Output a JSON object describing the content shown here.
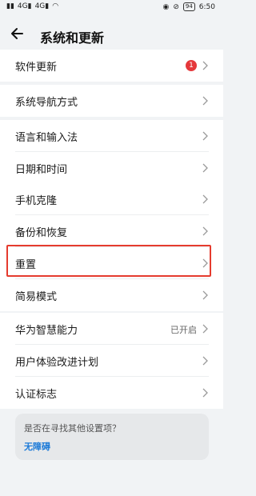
{
  "status_bar": {
    "left": [
      "HD",
      "4G",
      "4G",
      "wifi"
    ],
    "battery": "94",
    "time": "6:50"
  },
  "header": {
    "title": "系统和更新"
  },
  "groups": [
    {
      "items": [
        {
          "label": "软件更新",
          "badge": "1"
        }
      ]
    },
    {
      "items": [
        {
          "label": "系统导航方式"
        }
      ]
    },
    {
      "items": [
        {
          "label": "语言和输入法"
        },
        {
          "label": "日期和时间"
        }
      ]
    },
    {
      "items": [
        {
          "label": "手机克隆"
        },
        {
          "label": "备份和恢复"
        },
        {
          "label": "重置"
        },
        {
          "label": "简易模式"
        }
      ]
    },
    {
      "items": [
        {
          "label": "华为智慧能力",
          "value": "已开启"
        },
        {
          "label": "用户体验改进计划"
        },
        {
          "label": "认证标志"
        }
      ]
    }
  ],
  "hint": {
    "question": "是否在寻找其他设置项？",
    "link": "无障碍"
  },
  "colors": {
    "highlight": "#e53b2e",
    "badge": "#e5383b",
    "link": "#1e7bd8"
  }
}
